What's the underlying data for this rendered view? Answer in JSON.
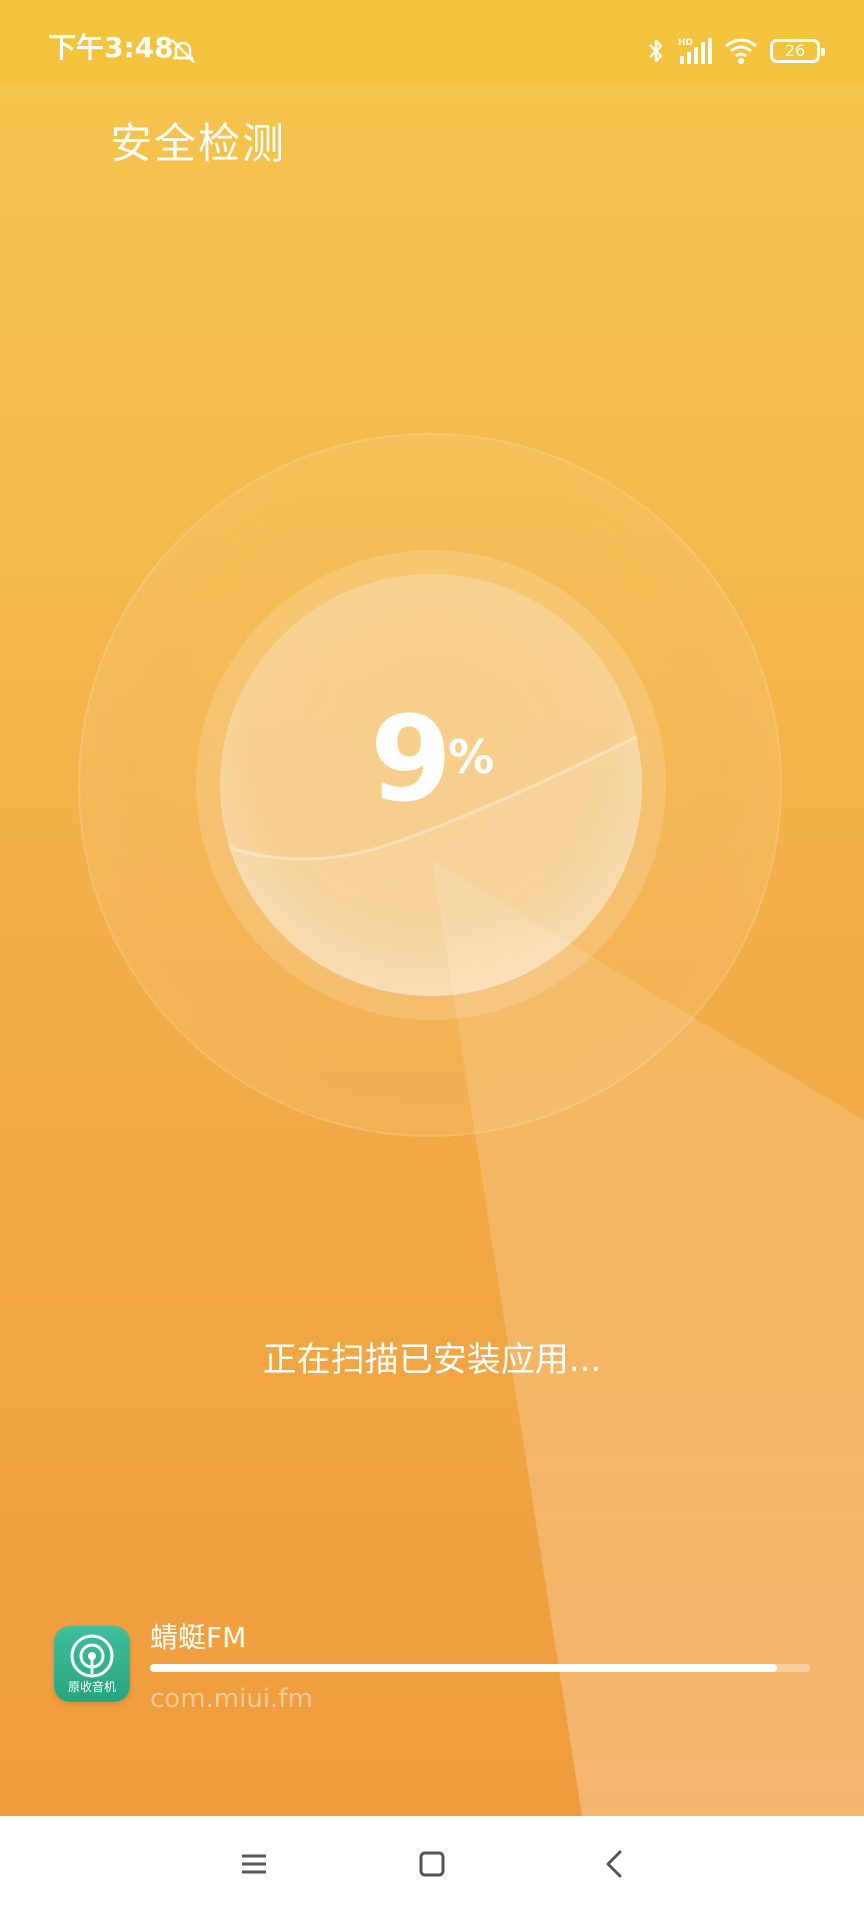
{
  "status_bar": {
    "time": "下午3:48",
    "left_icon": "alarm-off-icon",
    "right_icons": [
      "bluetooth-icon",
      "hd-signal-icon",
      "wifi-icon"
    ],
    "battery": "26"
  },
  "header": {
    "title": "安全检测"
  },
  "scan": {
    "percent_value": "9",
    "percent_sign": "%",
    "status_text": "正在扫描已安装应用..."
  },
  "current_app": {
    "name": "蜻蜓FM",
    "package": "com.miui.fm",
    "icon_caption": "原收音机",
    "progress": 0.95
  },
  "nav_bar": {
    "buttons": [
      "menu-icon",
      "home-icon",
      "back-icon"
    ]
  },
  "colors": {
    "status_bar": "#f4c33d",
    "gradient_top": "#f5c64c",
    "gradient_bottom": "#ef9a3c",
    "app_icon": "#2fae89"
  }
}
